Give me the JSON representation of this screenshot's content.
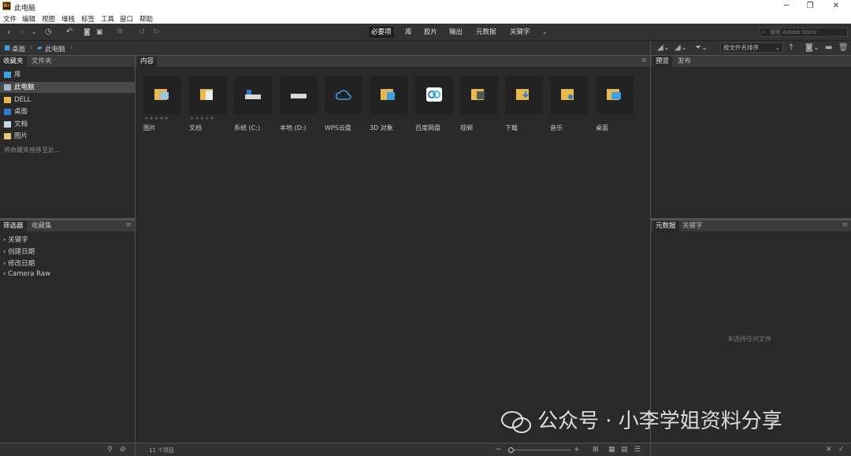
{
  "window": {
    "title": "此电脑",
    "app_icon": "Br"
  },
  "menu": [
    "文件",
    "编辑",
    "视图",
    "堆栈",
    "标签",
    "工具",
    "窗口",
    "帮助"
  ],
  "workspaces": [
    "必要项",
    "库",
    "胶片",
    "输出",
    "元数据",
    "关键字"
  ],
  "search": {
    "placeholder": "搜索 Adobe Stock"
  },
  "breadcrumb": [
    "桌面",
    "此电脑"
  ],
  "sort": {
    "label": "按文件名排序"
  },
  "left_top": {
    "tabs": [
      "收藏夹",
      "文件夹"
    ],
    "items": [
      "库",
      "此电脑",
      "DELL",
      "桌面",
      "文档",
      "图片"
    ],
    "hint": "将收藏夹拖移至此..."
  },
  "left_bottom": {
    "tabs": [
      "筛选器",
      "收藏集"
    ],
    "filters": [
      "关键字",
      "创建日期",
      "修改日期",
      "Camera Raw"
    ]
  },
  "content": {
    "tab": "内容",
    "items": [
      "图片",
      "文档",
      "系统 (C:)",
      "本地 (D:)",
      "WPS云盘",
      "3D 对象",
      "百度网盘",
      "视频",
      "下载",
      "音乐",
      "桌面"
    ]
  },
  "right_top": {
    "tabs": [
      "预览",
      "发布"
    ]
  },
  "right_bottom": {
    "tabs": [
      "元数据",
      "关键字"
    ],
    "empty": "未选择任何文件"
  },
  "status": {
    "count": "11 个项目"
  },
  "watermark": "公众号 · 小李学姐资料分享",
  "colors": {
    "accent": "#2b7cd3",
    "folder": "#e8b84a",
    "blue": "#3aa0e8"
  }
}
